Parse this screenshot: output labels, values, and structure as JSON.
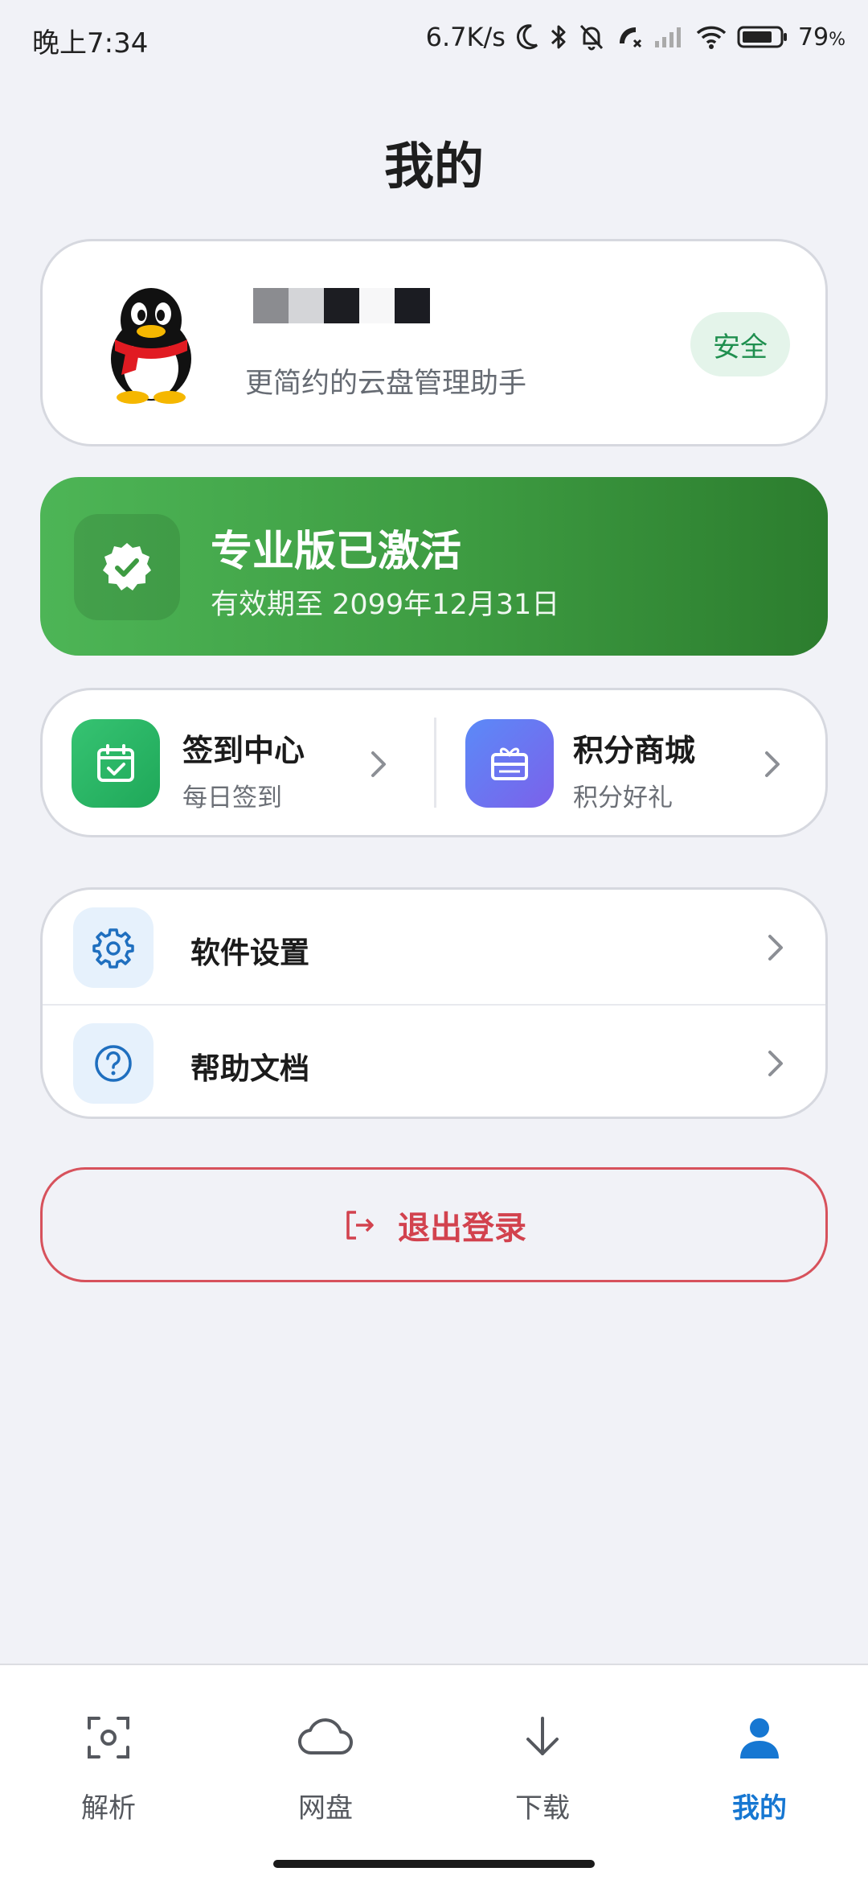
{
  "status_bar": {
    "time": "晚上7:34",
    "net_speed": "6.7K/s",
    "battery": "79",
    "battery_unit": "%"
  },
  "page": {
    "title": "我的"
  },
  "profile": {
    "subtitle": "更简约的云盘管理助手",
    "badge": "安全",
    "name_mask_colors": [
      "#8b8c90",
      "#d4d5d8",
      "#1c1d22",
      "#f7f7f8",
      "#1b1c22"
    ]
  },
  "pro": {
    "title": "专业版已激活",
    "subtitle": "有效期至 2099年12月31日"
  },
  "quick": [
    {
      "title": "签到中心",
      "subtitle": "每日签到",
      "icon": "calendar-check-icon"
    },
    {
      "title": "积分商城",
      "subtitle": "积分好礼",
      "icon": "gift-card-icon"
    }
  ],
  "settings": [
    {
      "label": "软件设置",
      "icon": "gear-icon"
    },
    {
      "label": "帮助文档",
      "icon": "help-circle-icon"
    }
  ],
  "logout": {
    "label": "退出登录"
  },
  "nav": {
    "items": [
      {
        "label": "解析",
        "icon": "scan-icon",
        "active": false
      },
      {
        "label": "网盘",
        "icon": "cloud-icon",
        "active": false
      },
      {
        "label": "下载",
        "icon": "download-arrow-icon",
        "active": false
      },
      {
        "label": "我的",
        "icon": "user-icon",
        "active": true
      }
    ],
    "active_color": "#1677d2"
  },
  "colors": {
    "pro_green": "#3d9b41",
    "logout_red": "#d2424e",
    "safe_green": "#1f8f4f"
  }
}
